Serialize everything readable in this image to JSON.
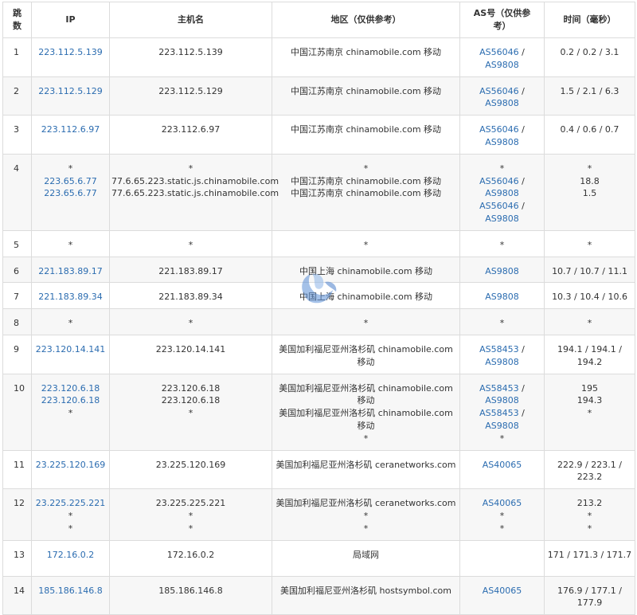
{
  "headers": {
    "hop": "跳数",
    "ip": "IP",
    "host": "主机名",
    "region": "地区（仅供参考）",
    "as": "AS号（仅供参考）",
    "time": "时间（毫秒）"
  },
  "rows": [
    {
      "hop": "1",
      "ips": [
        "223.112.5.139"
      ],
      "hosts": [
        "223.112.5.139"
      ],
      "regions": [
        "中国江苏南京 chinamobile.com 移动"
      ],
      "as": [
        [
          "AS56046",
          "AS9808"
        ]
      ],
      "times": [
        "0.2 / 0.2 / 3.1"
      ]
    },
    {
      "hop": "2",
      "ips": [
        "223.112.5.129"
      ],
      "hosts": [
        "223.112.5.129"
      ],
      "regions": [
        "中国江苏南京 chinamobile.com 移动"
      ],
      "as": [
        [
          "AS56046",
          "AS9808"
        ]
      ],
      "times": [
        "1.5 / 2.1 / 6.3"
      ]
    },
    {
      "hop": "3",
      "ips": [
        "223.112.6.97"
      ],
      "hosts": [
        "223.112.6.97"
      ],
      "regions": [
        "中国江苏南京 chinamobile.com 移动"
      ],
      "as": [
        [
          "AS56046",
          "AS9808"
        ]
      ],
      "times": [
        "0.4 / 0.6 / 0.7"
      ]
    },
    {
      "hop": "4",
      "ips": [
        "*",
        "223.65.6.77",
        "223.65.6.77"
      ],
      "hosts": [
        "*",
        "77.6.65.223.static.js.chinamobile.com",
        "77.6.65.223.static.js.chinamobile.com"
      ],
      "regions": [
        "*",
        "中国江苏南京 chinamobile.com 移动",
        "中国江苏南京 chinamobile.com 移动"
      ],
      "as": [
        [
          "*"
        ],
        [
          "AS56046",
          "AS9808"
        ],
        [
          "AS56046",
          "AS9808"
        ]
      ],
      "times": [
        "*",
        "18.8",
        "1.5"
      ]
    },
    {
      "hop": "5",
      "ips": [
        "*"
      ],
      "hosts": [
        "*"
      ],
      "regions": [
        "*"
      ],
      "as": [
        [
          "*"
        ]
      ],
      "times": [
        "*"
      ]
    },
    {
      "hop": "6",
      "ips": [
        "221.183.89.17"
      ],
      "hosts": [
        "221.183.89.17"
      ],
      "regions": [
        "中国上海 chinamobile.com 移动"
      ],
      "as": [
        [
          "AS9808"
        ]
      ],
      "times": [
        "10.7 / 10.7 / 11.1"
      ]
    },
    {
      "hop": "7",
      "ips": [
        "221.183.89.34"
      ],
      "hosts": [
        "221.183.89.34"
      ],
      "regions": [
        "中国上海 chinamobile.com 移动"
      ],
      "as": [
        [
          "AS9808"
        ]
      ],
      "times": [
        "10.3 / 10.4 / 10.6"
      ]
    },
    {
      "hop": "8",
      "ips": [
        "*"
      ],
      "hosts": [
        "*"
      ],
      "regions": [
        "*"
      ],
      "as": [
        [
          "*"
        ]
      ],
      "times": [
        "*"
      ]
    },
    {
      "hop": "9",
      "ips": [
        "223.120.14.141"
      ],
      "hosts": [
        "223.120.14.141"
      ],
      "regions": [
        "美国加利福尼亚州洛杉矶 chinamobile.com 移动"
      ],
      "as": [
        [
          "AS58453",
          "AS9808"
        ]
      ],
      "times": [
        "194.1 / 194.1 / 194.2"
      ]
    },
    {
      "hop": "10",
      "ips": [
        "223.120.6.18",
        "223.120.6.18",
        "*"
      ],
      "hosts": [
        "223.120.6.18",
        "223.120.6.18",
        "*"
      ],
      "regions": [
        "美国加利福尼亚州洛杉矶 chinamobile.com 移动",
        "美国加利福尼亚州洛杉矶 chinamobile.com 移动",
        "*"
      ],
      "as": [
        [
          "AS58453",
          "AS9808"
        ],
        [
          "AS58453",
          "AS9808"
        ],
        [
          "*"
        ]
      ],
      "times": [
        "195",
        "194.3",
        "*"
      ]
    },
    {
      "hop": "11",
      "ips": [
        "23.225.120.169"
      ],
      "hosts": [
        "23.225.120.169"
      ],
      "regions": [
        "美国加利福尼亚州洛杉矶 ceranetworks.com"
      ],
      "as": [
        [
          "AS40065"
        ]
      ],
      "times": [
        "222.9 / 223.1 / 223.2"
      ]
    },
    {
      "hop": "12",
      "ips": [
        "23.225.225.221",
        "*",
        "*"
      ],
      "hosts": [
        "23.225.225.221",
        "*",
        "*"
      ],
      "regions": [
        "美国加利福尼亚州洛杉矶 ceranetworks.com",
        "*",
        "*"
      ],
      "as": [
        [
          "AS40065"
        ],
        [
          "*"
        ],
        [
          "*"
        ]
      ],
      "times": [
        "213.2",
        "*",
        "*"
      ]
    },
    {
      "hop": "13",
      "ips": [
        "172.16.0.2"
      ],
      "hosts": [
        "172.16.0.2"
      ],
      "regions": [
        "局域网"
      ],
      "as": [
        []
      ],
      "times": [
        "171 / 171.3 / 171.7"
      ]
    },
    {
      "hop": "14",
      "ips": [
        "185.186.146.8"
      ],
      "hosts": [
        "185.186.146.8"
      ],
      "regions": [
        "美国加利福尼亚州洛杉矶 hostsymbol.com"
      ],
      "as": [
        [
          "AS40065"
        ]
      ],
      "times": [
        "176.9 / 177.1 / 177.9"
      ]
    }
  ],
  "colors": {
    "link": "#2b6cb0",
    "border": "#dcdcdc",
    "stripe": "#f7f7f7"
  }
}
